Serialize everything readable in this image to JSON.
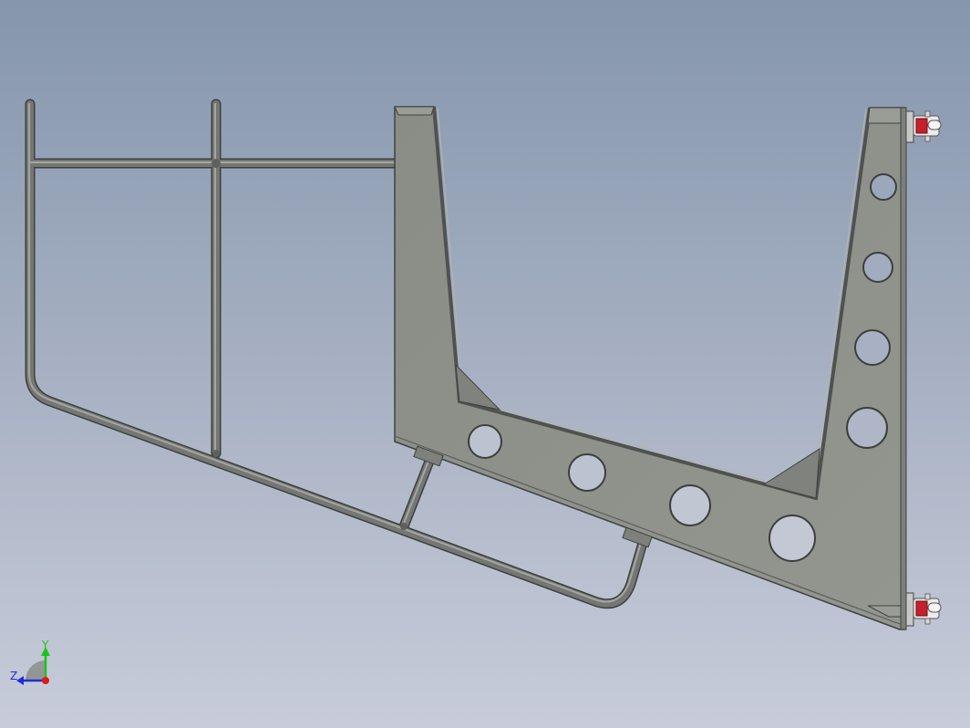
{
  "viewport": {
    "background_top": "#8596ad",
    "background_bottom": "#c8ccda"
  },
  "model": {
    "plate_color": "#8e918a",
    "plate_edge_color": "#4a4d4a",
    "tube_color": "#6c6f6c",
    "caster_body_color": "#e8e8e8",
    "caster_accent_color": "#c8202a",
    "hole_count_bottom_chord": 4,
    "hole_count_right_leg": 4,
    "caster_count": 2
  },
  "triad": {
    "y_label": "Y",
    "z_label": "Z",
    "y_color": "#19c419",
    "z_color": "#1c2fd6",
    "origin_color": "#e01818"
  }
}
